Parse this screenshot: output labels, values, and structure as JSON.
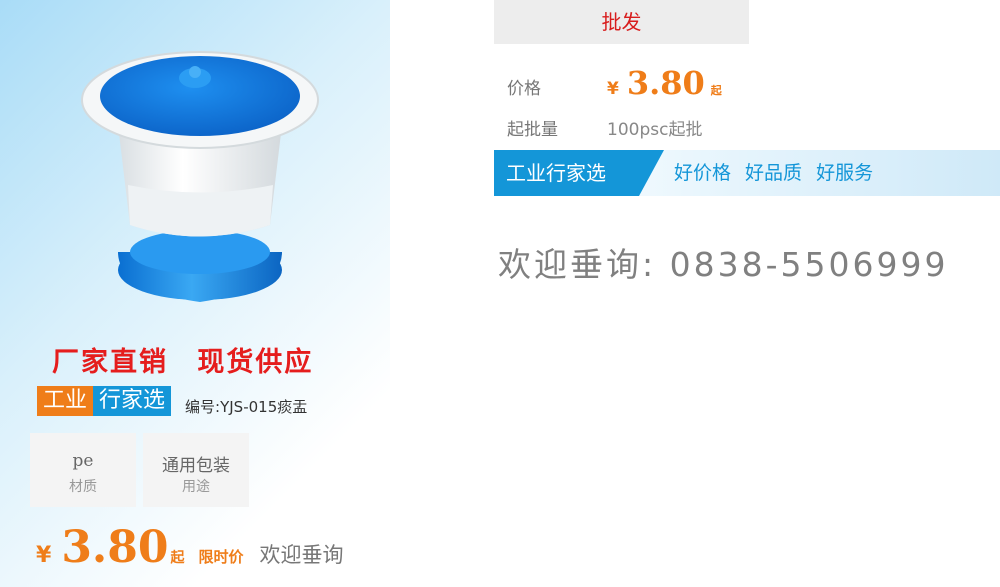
{
  "product": {
    "slogan": "厂家直销  现货供应",
    "brand_a": "工业",
    "brand_b": "行家选",
    "model": "编号:YJS-015痰盂",
    "image_alt": "blue-white-spittoon"
  },
  "specs": [
    {
      "value": "pe",
      "key": "材质"
    },
    {
      "value": "通用包装",
      "key": "用途"
    }
  ],
  "bottom_price": {
    "currency": "¥",
    "value": "3.80",
    "suffix": "起",
    "limited": "限时价",
    "inquire": "欢迎垂询"
  },
  "wholesale": {
    "tab": "批发",
    "price_label": "价格",
    "currency": "¥",
    "price": "3.80",
    "price_suffix": "起",
    "moq_label": "起批量",
    "moq_value": "100psc起批"
  },
  "banner": {
    "tag": "工业行家选",
    "text": "好价格 好品质 好服务"
  },
  "contact": "欢迎垂询: 0838-5506999",
  "colors": {
    "accent_orange": "#ef7d19",
    "accent_blue": "#1496d8",
    "accent_red": "#e51d1d"
  }
}
